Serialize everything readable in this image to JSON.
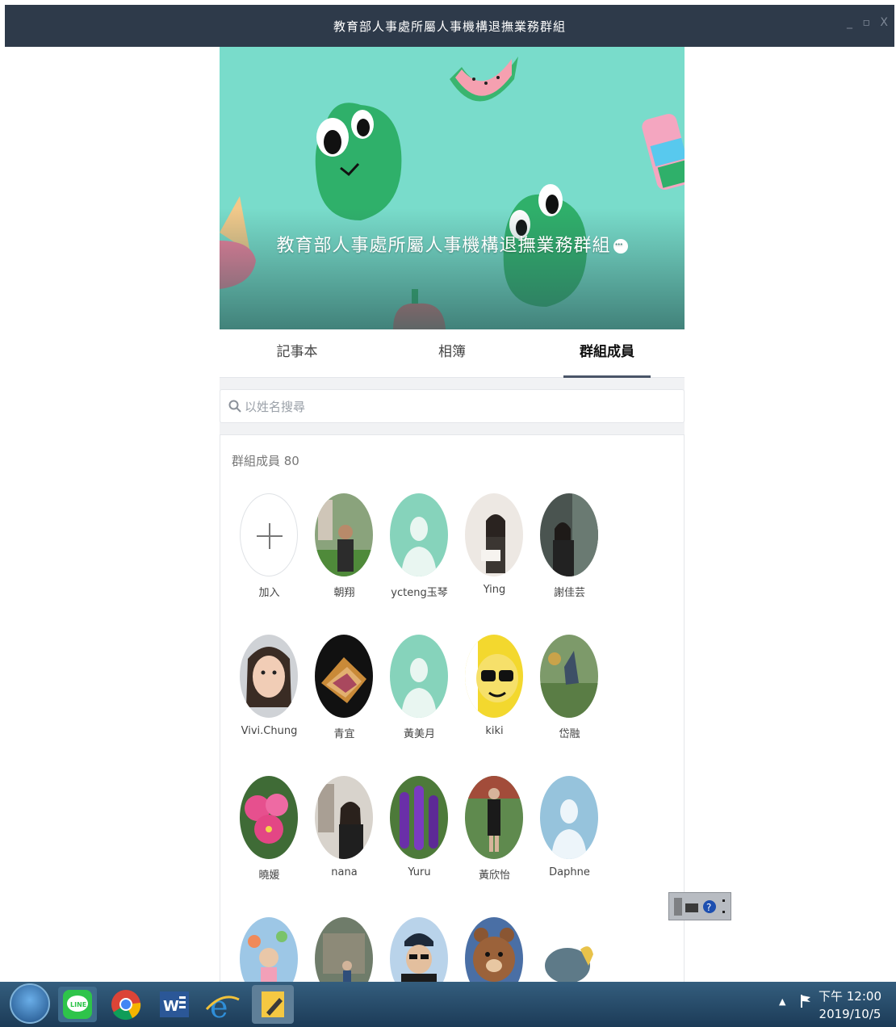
{
  "window": {
    "title": "教育部人事處所屬人事機構退撫業務群組",
    "controls": [
      "_",
      "▫",
      "X"
    ]
  },
  "group": {
    "name": "教育部人事處所屬人事機構退撫業務群組"
  },
  "tabs": [
    {
      "label": "記事本",
      "active": false
    },
    {
      "label": "相簿",
      "active": false
    },
    {
      "label": "群組成員",
      "active": true
    }
  ],
  "search": {
    "placeholder": "以姓名搜尋",
    "value": ""
  },
  "members": {
    "title": "群組成員 80",
    "add_label": "加入",
    "list": [
      {
        "name": "朝翔",
        "avatar": "photo"
      },
      {
        "name": "ycteng玉琴",
        "avatar": "default-green"
      },
      {
        "name": "Ying",
        "avatar": "photo"
      },
      {
        "name": "謝佳芸",
        "avatar": "photo"
      },
      {
        "name": "Vivi.Chung",
        "avatar": "photo"
      },
      {
        "name": "青宜",
        "avatar": "photo"
      },
      {
        "name": "黃美月",
        "avatar": "default-green"
      },
      {
        "name": "kiki",
        "avatar": "photo"
      },
      {
        "name": "岱融",
        "avatar": "photo"
      },
      {
        "name": "曉媛",
        "avatar": "photo"
      },
      {
        "name": "nana",
        "avatar": "photo"
      },
      {
        "name": "Yuru",
        "avatar": "photo"
      },
      {
        "name": "黃欣怡",
        "avatar": "photo"
      },
      {
        "name": "Daphne",
        "avatar": "default-blue"
      },
      {
        "name": "",
        "avatar": "photo"
      },
      {
        "name": "",
        "avatar": "photo"
      },
      {
        "name": "",
        "avatar": "photo"
      },
      {
        "name": "",
        "avatar": "photo"
      },
      {
        "name": "",
        "avatar": "photo"
      }
    ]
  },
  "taskbar": {
    "apps": [
      "start-orb",
      "line",
      "chrome",
      "word",
      "internet-explorer",
      "notes"
    ],
    "clock_time": "下午 12:00",
    "clock_date": "2019/10/5"
  },
  "colors": {
    "titlebar": "#2e3a4a",
    "cover": "#79dccb",
    "default_avatar_green": "#86d3bb",
    "default_avatar_blue": "#96c3dc"
  }
}
